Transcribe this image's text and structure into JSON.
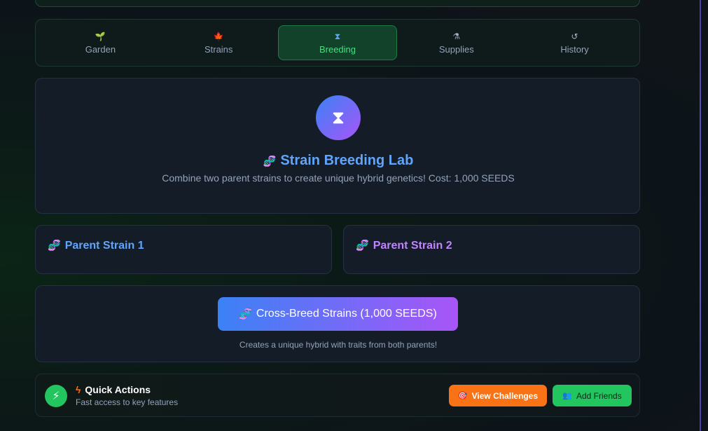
{
  "tabs": [
    {
      "label": "Garden",
      "icon": "sprout-icon",
      "glyph": "🌱"
    },
    {
      "label": "Strains",
      "icon": "leaf-icon",
      "glyph": "🍁"
    },
    {
      "label": "Breeding",
      "icon": "hourglass-icon",
      "glyph": "⧗",
      "active": true
    },
    {
      "label": "Supplies",
      "icon": "flask-icon",
      "glyph": "⚗"
    },
    {
      "label": "History",
      "icon": "history-icon",
      "glyph": "↺"
    }
  ],
  "hero": {
    "icon_glyph": "⧗",
    "title_icon": "🧬",
    "title": "Strain Breeding Lab",
    "subtitle": "Combine two parent strains to create unique hybrid genetics! Cost: 1,000 SEEDS"
  },
  "parents": [
    {
      "icon": "🧬",
      "label": "Parent Strain 1"
    },
    {
      "icon": "🧬",
      "label": "Parent Strain 2"
    }
  ],
  "cross": {
    "icon": "🧬",
    "button_label": "Cross-Breed Strains (1,000 SEEDS)",
    "note": "Creates a unique hybrid with traits from both parents!"
  },
  "quick_actions": {
    "icon_glyph": "⚡",
    "title_icon": "ϟ",
    "title": "Quick Actions",
    "subtitle": "Fast access to key features",
    "challenges_icon": "🎯",
    "challenges_label": "View Challenges",
    "friends_icon": "👥",
    "friends_label": "Add Friends"
  },
  "colors": {
    "accent_blue": "#60a5fa",
    "accent_purple": "#c084fc",
    "active_green": "#4ade80",
    "orange": "#f97316",
    "green": "#22c55e"
  }
}
